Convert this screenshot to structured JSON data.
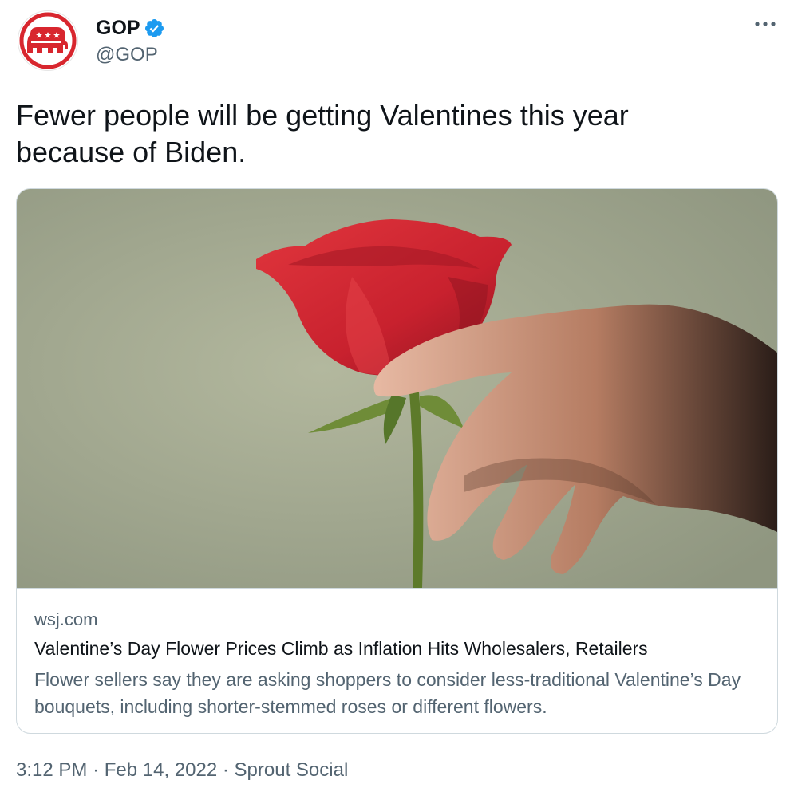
{
  "author": {
    "display_name": "GOP",
    "handle": "@GOP",
    "verified": true,
    "avatar_icon": "republican-elephant-icon",
    "brand_color": "#d8262e",
    "verified_color": "#1d9bf0"
  },
  "more_icon": "more-horizontal-icon",
  "tweet": {
    "text": "Fewer people will be getting Valentines this year because of Biden."
  },
  "card": {
    "image_description_icon": "rose-and-hand-photo",
    "domain": "wsj.com",
    "title": "Valentine’s Day Flower Prices Climb as Inflation Hits Wholesalers, Retailers",
    "description": "Flower sellers say they are asking shoppers to consider less-traditional Valentine’s Day bouquets, including shorter-stemmed roses or different flowers."
  },
  "meta": {
    "time": "3:12 PM",
    "separator": "·",
    "date": "Feb 14, 2022",
    "source": "Sprout Social"
  },
  "colors": {
    "text_primary": "#0f1419",
    "text_secondary": "#536471",
    "border": "#cfd9de",
    "photo_background": "#a7ad93",
    "rose_red": "#c8212e"
  }
}
